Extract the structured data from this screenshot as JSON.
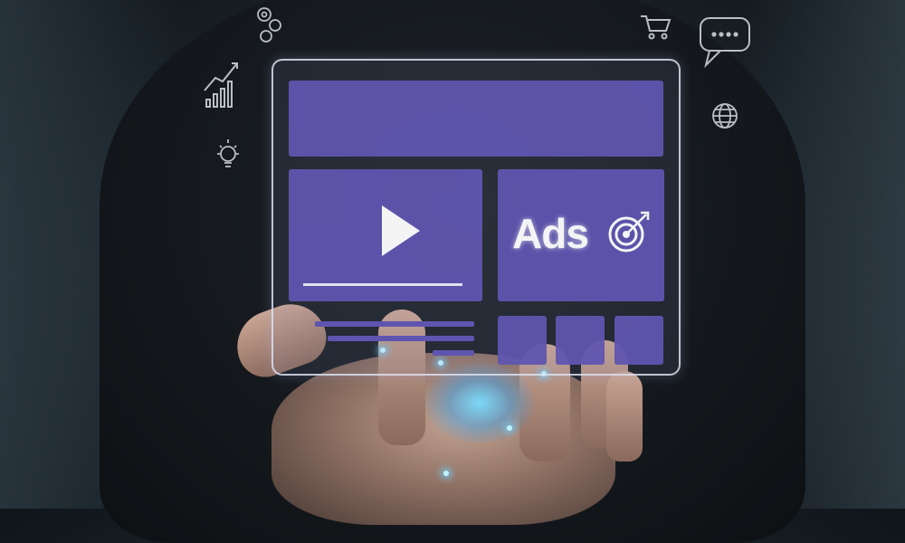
{
  "screen": {
    "ads_label": "Ads"
  },
  "icons": [
    "gears-icon",
    "growth-chart-icon",
    "lightbulb-icon",
    "shopping-cart-icon",
    "chat-bubble-icon",
    "globe-icon",
    "play-icon",
    "target-icon"
  ],
  "colors": {
    "tile": "#5f55b0",
    "glow": "#78dcff",
    "background": "#1c252c"
  }
}
